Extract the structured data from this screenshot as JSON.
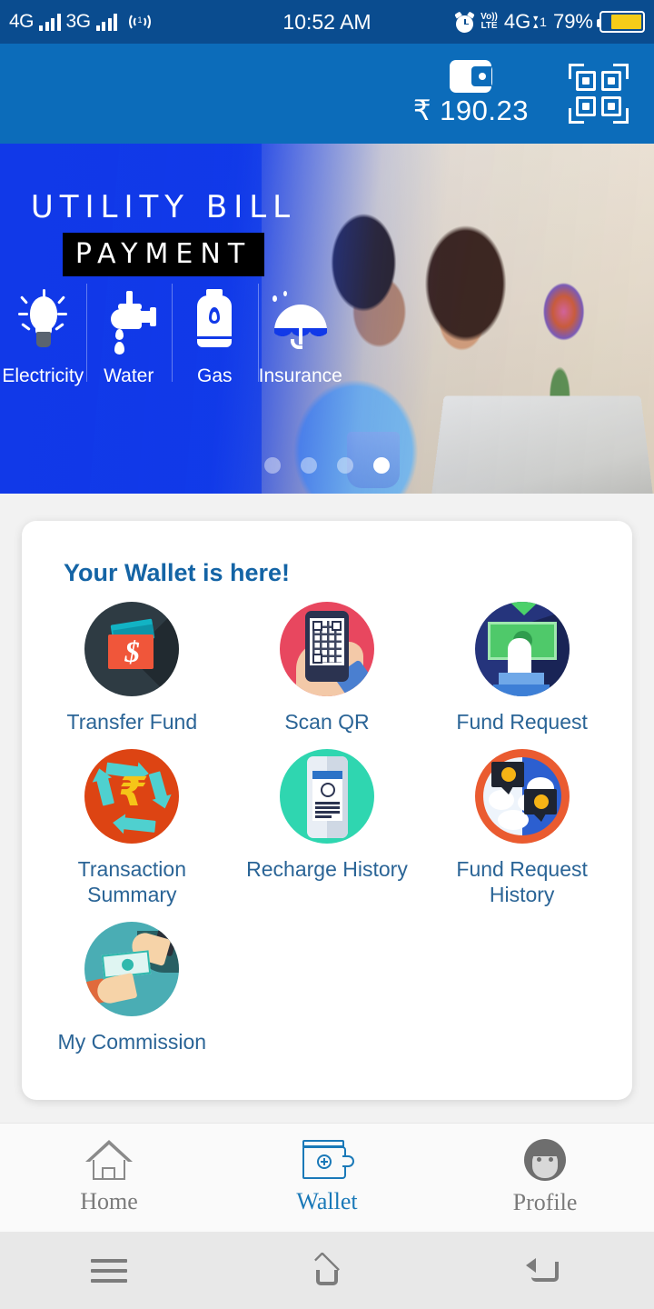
{
  "status_bar": {
    "sim1_network": "4G",
    "sim2_network": "3G",
    "hotspot_icon": "hotspot-icon",
    "time": "10:52 AM",
    "alarm_icon": "alarm-icon",
    "volte_line1": "Vo))",
    "volte_line2": "LTE",
    "data_network": "4G",
    "data_suffix": "1",
    "battery_percent": "79%"
  },
  "app_header": {
    "wallet_icon": "wallet-icon",
    "balance": "₹ 190.23",
    "qr_icon": "qr-scanner-icon"
  },
  "banner": {
    "title_line1": "UTILITY BILL",
    "title_line2": "PAYMENT",
    "services": [
      {
        "label": "Electricity",
        "icon": "lightbulb-icon"
      },
      {
        "label": "Water",
        "icon": "faucet-icon"
      },
      {
        "label": "Gas",
        "icon": "gas-cylinder-icon"
      },
      {
        "label": "Insurance",
        "icon": "umbrella-icon"
      }
    ],
    "carousel": {
      "total": 4,
      "active_index": 3
    }
  },
  "wallet_card": {
    "title": "Your Wallet is here!",
    "items": [
      {
        "label": "Transfer Fund",
        "icon": "transfer-fund-icon"
      },
      {
        "label": "Scan QR",
        "icon": "scan-qr-icon"
      },
      {
        "label": "Fund Request",
        "icon": "fund-request-icon"
      },
      {
        "label": "Transaction Summary",
        "icon": "transaction-summary-icon"
      },
      {
        "label": "Recharge History",
        "icon": "recharge-history-icon"
      },
      {
        "label": "Fund Request History",
        "icon": "fund-request-history-icon"
      },
      {
        "label": "My Commission",
        "icon": "my-commission-icon"
      }
    ]
  },
  "bottom_nav": {
    "items": [
      {
        "label": "Home",
        "icon": "home-icon",
        "active": false
      },
      {
        "label": "Wallet",
        "icon": "wallet-nav-icon",
        "active": true
      },
      {
        "label": "Profile",
        "icon": "profile-icon",
        "active": false
      }
    ]
  },
  "android_nav": {
    "menu_icon": "menu-icon",
    "home_icon": "android-home-icon",
    "back_icon": "back-icon"
  },
  "colors": {
    "status_bar_bg": "#0a4c8f",
    "header_bg": "#0c6cba",
    "banner_blue": "#1139e8",
    "card_title": "#1464a5",
    "item_label": "#2a6496",
    "active_nav": "#1a79b8",
    "inactive_nav": "#7a7a7a",
    "page_bg": "#f2f2f2",
    "battery_fill": "#f5cc18"
  }
}
